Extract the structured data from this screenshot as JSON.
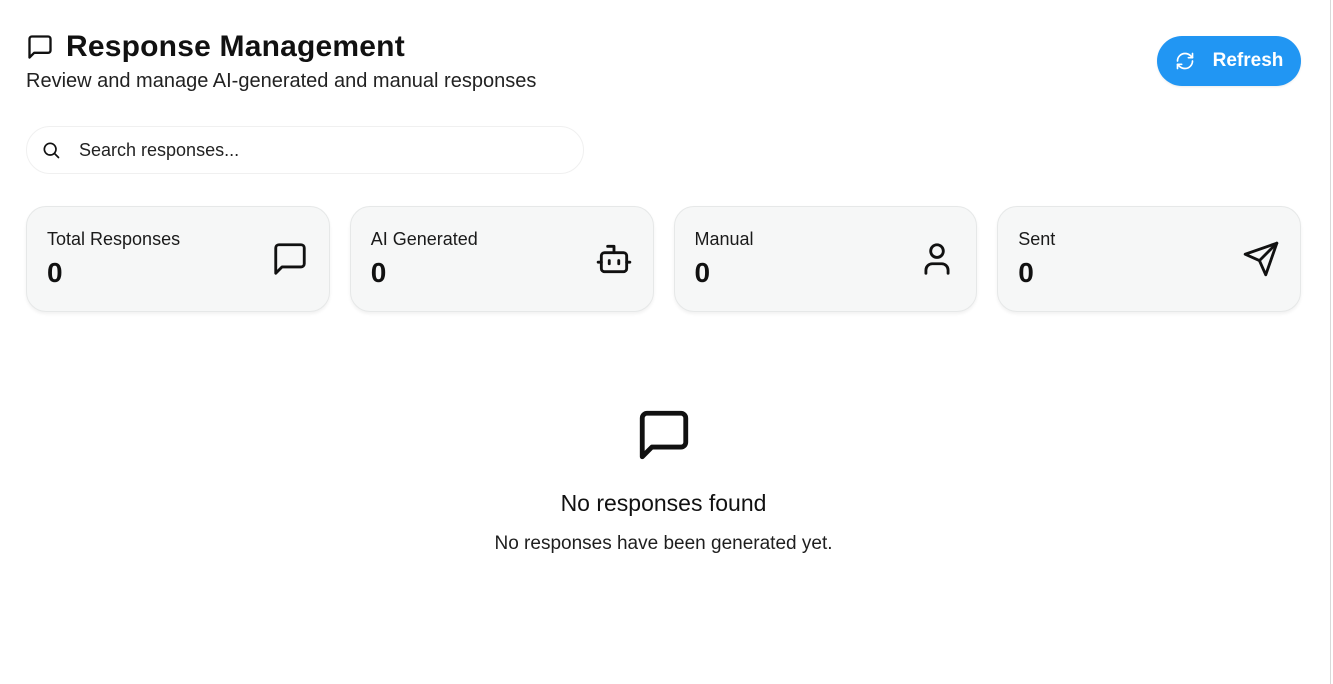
{
  "header": {
    "title": "Response Management",
    "subtitle": "Review and manage AI-generated and manual responses",
    "title_icon": "message-square-icon"
  },
  "toolbar": {
    "refresh_label": "Refresh",
    "refresh_icon": "refresh-cw-icon"
  },
  "search": {
    "placeholder": "Search responses...",
    "value": "",
    "icon": "search-icon"
  },
  "stats": [
    {
      "label": "Total Responses",
      "value": "0",
      "icon": "message-square-icon"
    },
    {
      "label": "AI Generated",
      "value": "0",
      "icon": "bot-icon"
    },
    {
      "label": "Manual",
      "value": "0",
      "icon": "user-icon"
    },
    {
      "label": "Sent",
      "value": "0",
      "icon": "send-icon"
    }
  ],
  "empty_state": {
    "icon": "message-square-icon",
    "title": "No responses found",
    "text": "No responses have been generated yet."
  },
  "colors": {
    "accent": "#2196f3",
    "card_background": "#f6f7f7",
    "text": "#111111"
  }
}
